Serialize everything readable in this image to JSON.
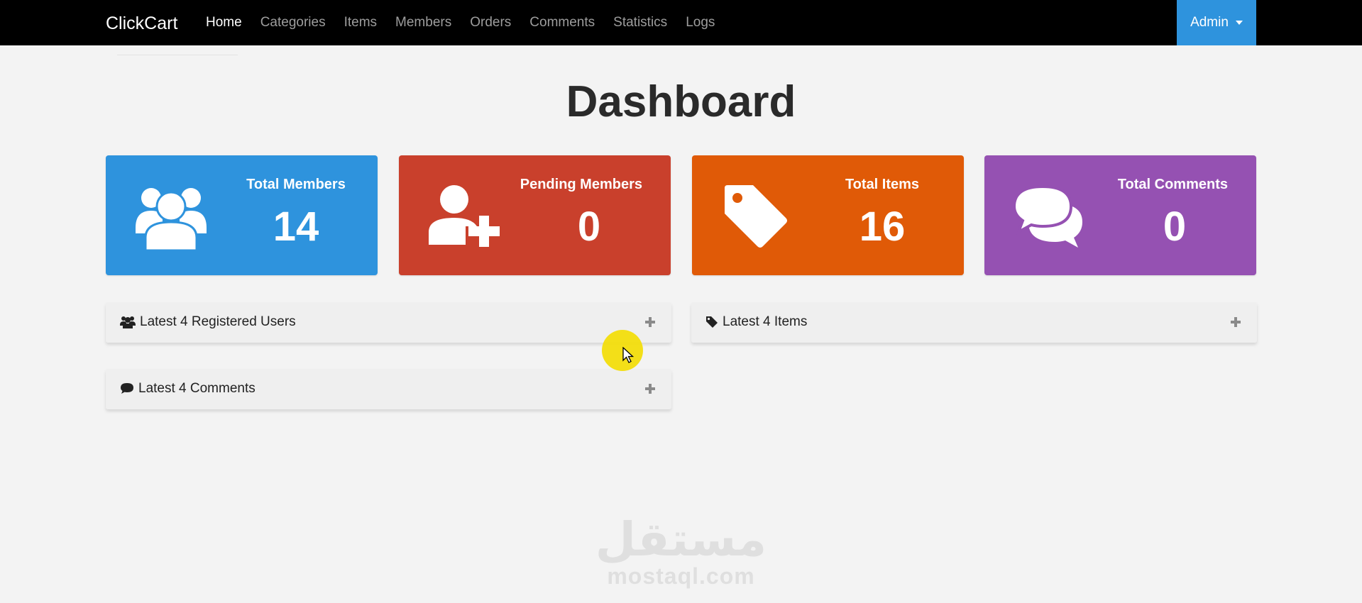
{
  "navbar": {
    "brand": "ClickCart",
    "links": [
      {
        "label": "Home",
        "active": true
      },
      {
        "label": "Categories",
        "active": false
      },
      {
        "label": "Items",
        "active": false
      },
      {
        "label": "Members",
        "active": false
      },
      {
        "label": "Orders",
        "active": false
      },
      {
        "label": "Comments",
        "active": false
      },
      {
        "label": "Statistics",
        "active": false
      },
      {
        "label": "Logs",
        "active": false
      }
    ],
    "user_menu": {
      "label": "Admin",
      "icon": "caret-down-icon"
    }
  },
  "page": {
    "title": "Dashboard"
  },
  "stats": [
    {
      "label": "Total Members",
      "value": "14",
      "icon": "users-icon",
      "color": "#2e93dd"
    },
    {
      "label": "Pending Members",
      "value": "0",
      "icon": "user-plus-icon",
      "color": "#c9402c"
    },
    {
      "label": "Total Items",
      "value": "16",
      "icon": "tag-icon",
      "color": "#e05a07"
    },
    {
      "label": "Total Comments",
      "value": "0",
      "icon": "comments-icon",
      "color": "#9551b2"
    }
  ],
  "panels": {
    "users": {
      "title": "Latest 4 Registered Users",
      "icon": "users-icon",
      "action_icon": "plus-icon"
    },
    "items": {
      "title": "Latest 4 Items",
      "icon": "tag-icon",
      "action_icon": "plus-icon"
    },
    "comments": {
      "title": "Latest 4 Comments",
      "icon": "comment-icon",
      "action_icon": "plus-icon"
    }
  },
  "watermark": {
    "arabic": "مستقل",
    "latin": "mostaql.com"
  }
}
